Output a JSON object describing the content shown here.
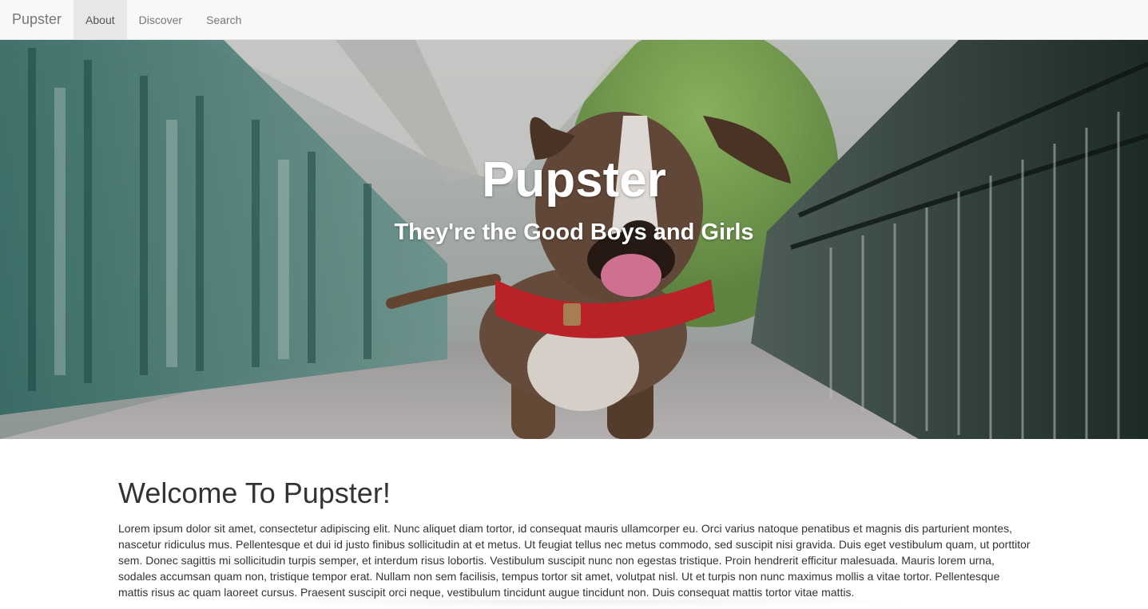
{
  "navbar": {
    "brand": "Pupster",
    "items": [
      {
        "label": "About",
        "active": true
      },
      {
        "label": "Discover",
        "active": false
      },
      {
        "label": "Search",
        "active": false
      }
    ]
  },
  "hero": {
    "title": "Pupster",
    "subtitle": "They're the Good Boys and Girls",
    "image": "dog-on-bridge"
  },
  "main": {
    "heading": "Welcome To Pupster!",
    "body": "Lorem ipsum dolor sit amet, consectetur adipiscing elit. Nunc aliquet diam tortor, id consequat mauris ullamcorper eu. Orci varius natoque penatibus et magnis dis parturient montes, nascetur ridiculus mus. Pellentesque et dui id justo finibus sollicitudin at et metus. Ut feugiat tellus nec metus commodo, sed suscipit nisi gravida. Duis eget vestibulum quam, ut porttitor sem. Donec sagittis mi sollicitudin turpis semper, et interdum risus lobortis. Vestibulum suscipit nunc non egestas tristique. Proin hendrerit efficitur malesuada. Mauris lorem urna, sodales accumsan quam non, tristique tempor erat. Nullam non sem facilisis, tempus tortor sit amet, volutpat nisl. Ut et turpis non nunc maximus mollis a vitae tortor. Pellentesque mattis risus ac quam laoreet cursus. Praesent suscipit orci neque, vestibulum tincidunt augue tincidunt non. Duis consequat mattis tortor vitae mattis."
  },
  "colors": {
    "navbar_bg": "#f8f8f8",
    "nav_active_bg": "#e7e7e7",
    "nav_text": "#777777",
    "text": "#333333"
  }
}
